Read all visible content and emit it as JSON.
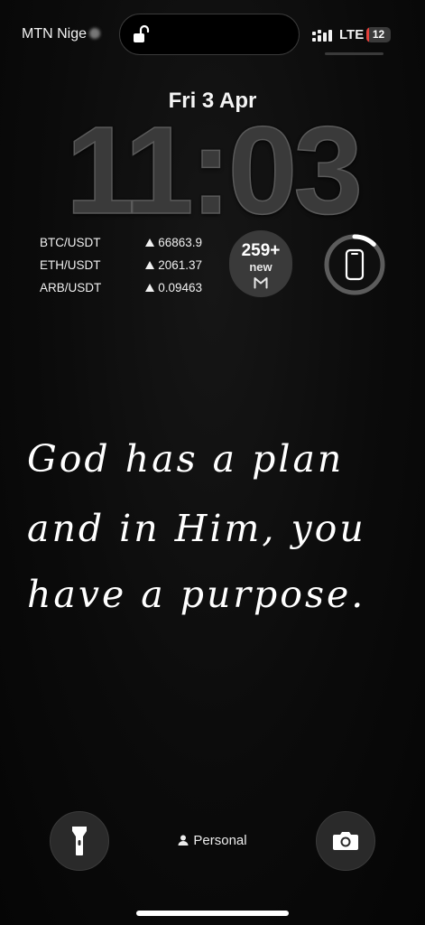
{
  "status_bar": {
    "carrier": "MTN Nige",
    "network": "LTE",
    "battery_level": "12",
    "battery_percent": 0.12,
    "colors": {
      "battery_low": "#e1403a"
    }
  },
  "lockscreen": {
    "date": "Fri 3 Apr",
    "time": "11:03",
    "focus_mode": "Personal"
  },
  "crypto_widget": {
    "rows": [
      {
        "pair": "BTC/USDT",
        "price": "66863.9",
        "direction": "up"
      },
      {
        "pair": "ETH/USDT",
        "price": "2061.37",
        "direction": "up"
      },
      {
        "pair": "ARB/USDT",
        "price": "0.09463",
        "direction": "up"
      }
    ]
  },
  "mail_widget": {
    "count": "259+",
    "label": "new",
    "icon": "gmail-icon"
  },
  "battery_widget": {
    "icon": "phone-icon",
    "level_percent": 0.12
  },
  "wallpaper_quote": {
    "lines": [
      "God has a plan",
      "and in Him, you",
      "have a purpose."
    ]
  },
  "controls": {
    "left_icon": "flashlight-icon",
    "right_icon": "camera-icon"
  }
}
